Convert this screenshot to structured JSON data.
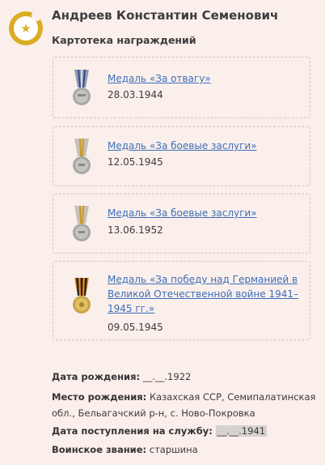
{
  "person": {
    "name": "Андреев Константин Семенович",
    "section_title": "Картотека награждений"
  },
  "awards": [
    {
      "title": "Медаль «За отвагу»",
      "date": "28.03.1944",
      "icon": "medal-za-otvagu-icon"
    },
    {
      "title": "Медаль «За боевые заслуги»",
      "date": "12.05.1945",
      "icon": "medal-boevye-zaslugi-icon"
    },
    {
      "title": "Медаль «За боевые заслуги»",
      "date": "13.06.1952",
      "icon": "medal-boevye-zaslugi-icon"
    },
    {
      "title_lines": [
        "Медаль «За победу над Германией в",
        "Великой Отечественной войне 1941–",
        "1945 гг.»"
      ],
      "date": "09.05.1945",
      "icon": "medal-pobeda-germaniya-icon"
    }
  ],
  "details": {
    "birth_date_label": "Дата рождения:",
    "birth_date_value": "__.__.1922",
    "birth_place_label": "Место рождения:",
    "birth_place_value_line1": "Казахская ССР, Семипалатинская",
    "birth_place_value_line2": "обл., Бельагачский р-н, с. Ново-Покровка",
    "service_start_label": "Дата поступления на службу:",
    "service_start_value": "__.__.1941",
    "rank_label": "Воинское звание:",
    "rank_value": "старшина"
  },
  "colors": {
    "background": "#fbefec",
    "accent": "#d9ad25",
    "link": "#3c6fb8",
    "card_border": "#d5c2be"
  }
}
